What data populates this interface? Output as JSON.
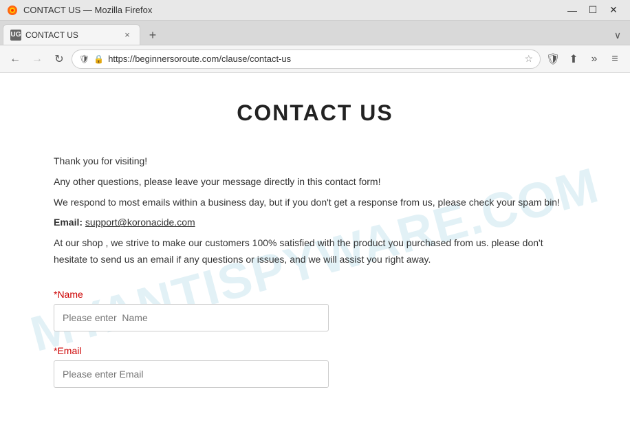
{
  "window": {
    "title": "CONTACT US — Mozilla Firefox",
    "favicon_label": "UG"
  },
  "tab": {
    "label": "CONTACT US",
    "close_label": "×"
  },
  "new_tab_button": "+",
  "tab_bar_chevron": "∨",
  "nav": {
    "back_btn": "←",
    "forward_btn": "→",
    "reload_btn": "↻",
    "url": "https://beginnersoroute.com/clause/contact-us",
    "star": "☆",
    "shield": "🛡",
    "share": "⬆",
    "more": "»",
    "menu": "≡",
    "lock_icon": "🔒"
  },
  "title_bar_controls": {
    "minimize": "—",
    "maximize": "☐",
    "close": "✕"
  },
  "page": {
    "heading": "CONTACT US",
    "watermark": "MYANTISPYWARE.COM",
    "intro_lines": [
      "Thank you for visiting!",
      "Any other questions, please leave your message directly in this contact form!",
      "We respond to most emails within a business day, but if you don't get a response from us, please check your spam bin!",
      "Email: support@koronacide.com",
      "At our shop , we strive to make our customers 100% satisfied with the product you purchased from us. please don't hesitate to send us an email if any questions or issues, and we will assist you right away."
    ],
    "email_text": "support@koronacide.com",
    "form": {
      "name_label": "*Name",
      "name_placeholder": "Please enter  Name",
      "email_label": "*Email",
      "email_placeholder": "Please enter Email"
    }
  }
}
